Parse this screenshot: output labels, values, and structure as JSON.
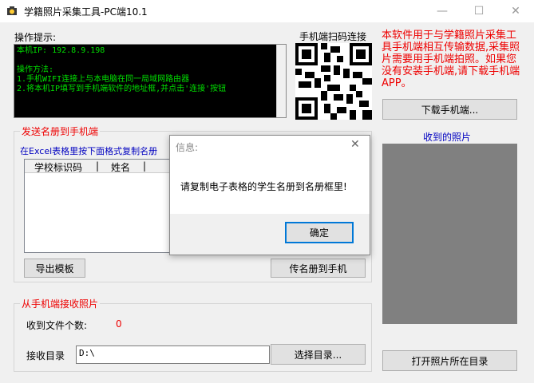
{
  "window": {
    "title": "学籍照片采集工具-PC端10.1",
    "minimize": "—",
    "maximize": "☐",
    "close": "✕"
  },
  "instructions": {
    "label": "操作提示:",
    "lines": [
      "本机IP: 192.8.9.198",
      "",
      "操作方法:",
      "1.手机WIFI连接上与本电脑在同一局域网路由器",
      "2.将本机IP填写到手机端软件的地址框,并点击'连接'按钮"
    ]
  },
  "qr": {
    "label": "手机端扫码连接"
  },
  "info_text": "本软件用于与学籍照片采集工具手机端相互传输数据,采集照片需要用手机端拍照。如果您没有安装手机端,请下载手机端APP。",
  "download_button": "下载手机端...",
  "received_label": "收到的照片",
  "send_group": {
    "title": "发送名册到手机端",
    "hint": "在Excel表格里按下面格式复制名册",
    "columns": [
      "学校标识码",
      "|",
      "姓名",
      "|"
    ],
    "export_button": "导出模板",
    "send_button": "传名册到手机"
  },
  "receive_group": {
    "title": "从手机端接收照片",
    "count_label": "收到文件个数:",
    "count_value": "0",
    "dir_label": "接收目录",
    "dir_value": "D:\\",
    "browse_button": "选择目录..."
  },
  "open_folder_button": "打开照片所在目录",
  "dialog": {
    "title": "信息:",
    "close": "✕",
    "message": "请复制电子表格的学生名册到名册框里!",
    "ok_button": "确定"
  },
  "colors": {
    "accent": "#0078d7",
    "warning_text": "#e00000",
    "console_text": "#00e000"
  }
}
